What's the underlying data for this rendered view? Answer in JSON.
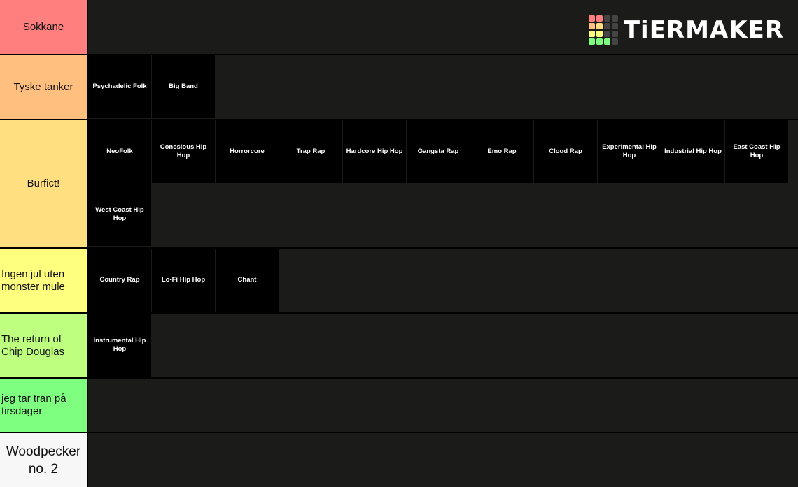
{
  "logo": {
    "text": "TiERMAKER",
    "grid_colors": [
      "#ff7f7f",
      "#ff7f7f",
      "#444444",
      "#444444",
      "#ffbf7f",
      "#ffdf7f",
      "#444444",
      "#444444",
      "#ffff7f",
      "#ffff7f",
      "#444444",
      "#444444",
      "#7fff7f",
      "#7fff7f",
      "#7fff7f",
      "#444444"
    ]
  },
  "tiers": [
    {
      "label": "Sokkane",
      "color": "#ff7f7f",
      "items": []
    },
    {
      "label": "Tyske tanker",
      "color": "#ffbf7f",
      "items": [
        "Psychadelic Folk",
        "Big Band"
      ]
    },
    {
      "label": "Burfict!",
      "color": "#ffdf7f",
      "items": [
        "NeoFolk",
        "Concsious Hip Hop",
        "Horrorcore",
        "Trap Rap",
        "Hardcore Hip Hop",
        "Gangsta Rap",
        "Emo Rap",
        "Cloud Rap",
        "Experimental Hip Hop",
        "Industrial Hip Hop",
        "East Coast Hip Hop",
        "West Coast Hip Hop"
      ]
    },
    {
      "label": "Ingen jul uten monster mule",
      "color": "#ffff7f",
      "items": [
        "Country Rap",
        "Lo-Fi Hip Hop",
        "Chant"
      ]
    },
    {
      "label": "The return of Chip Douglas",
      "color": "#bfff7f",
      "items": [
        "Instrumental Hip Hop"
      ]
    },
    {
      "label": "jeg tar tran på tirsdager",
      "color": "#7fff7f",
      "items": []
    },
    {
      "label": "Woodpecker no. 2",
      "color": "#f7f7f7",
      "items": []
    }
  ]
}
